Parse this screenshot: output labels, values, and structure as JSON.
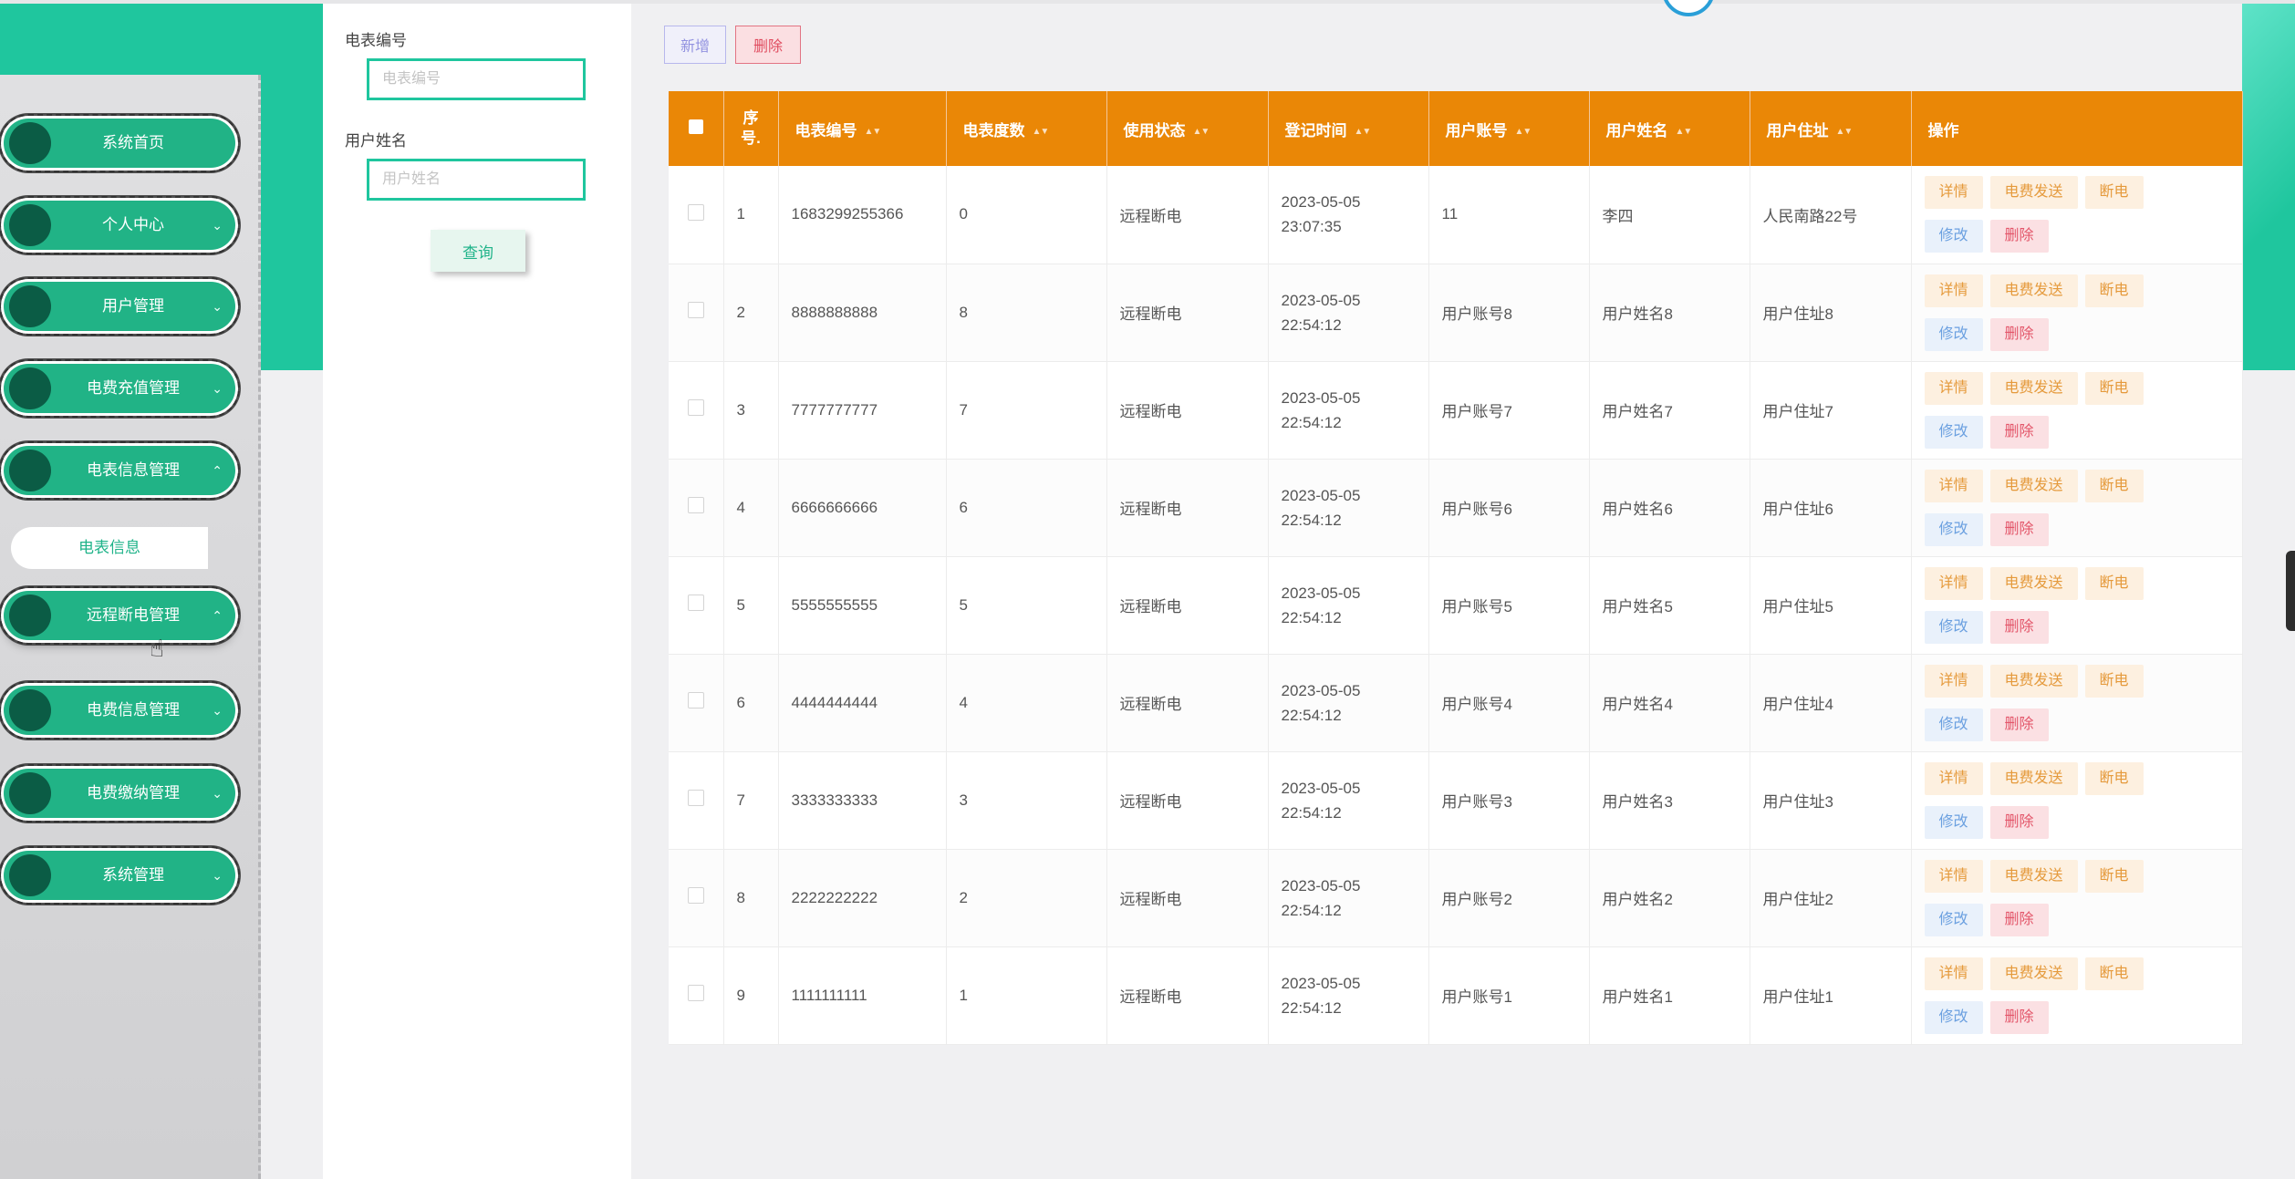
{
  "sidebar": {
    "items": [
      {
        "label": "系统首页",
        "chevron": ""
      },
      {
        "label": "个人中心",
        "chevron": "⌄"
      },
      {
        "label": "用户管理",
        "chevron": "⌄"
      },
      {
        "label": "电费充值管理",
        "chevron": "⌄"
      },
      {
        "label": "电表信息管理",
        "chevron": "⌃"
      },
      {
        "label": "远程断电管理",
        "chevron": "⌃"
      },
      {
        "label": "电费信息管理",
        "chevron": "⌄"
      },
      {
        "label": "电费缴纳管理",
        "chevron": "⌄"
      },
      {
        "label": "系统管理",
        "chevron": "⌄"
      }
    ],
    "submenu_item": "电表信息"
  },
  "search": {
    "meter_label": "电表编号",
    "meter_placeholder": "电表编号",
    "name_label": "用户姓名",
    "name_placeholder": "用户姓名",
    "query_button": "查询"
  },
  "toolbar": {
    "add_label": "新增",
    "delete_label": "删除"
  },
  "table": {
    "headers": {
      "index": "序号.",
      "meter_no": "电表编号",
      "meter_reading": "电表度数",
      "status": "使用状态",
      "register_time": "登记时间",
      "account": "用户账号",
      "name": "用户姓名",
      "address": "用户住址",
      "actions": "操作"
    },
    "actions": {
      "detail": "详情",
      "send": "电费发送",
      "cut": "断电",
      "edit": "修改",
      "delete": "删除"
    },
    "rows": [
      {
        "index": "1",
        "meter_no": "1683299255366",
        "reading": "0",
        "status": "远程断电",
        "time": "2023-05-05 23:07:35",
        "account": "11",
        "name": "李四",
        "address": "人民南路22号"
      },
      {
        "index": "2",
        "meter_no": "8888888888",
        "reading": "8",
        "status": "远程断电",
        "time": "2023-05-05 22:54:12",
        "account": "用户账号8",
        "name": "用户姓名8",
        "address": "用户住址8"
      },
      {
        "index": "3",
        "meter_no": "7777777777",
        "reading": "7",
        "status": "远程断电",
        "time": "2023-05-05 22:54:12",
        "account": "用户账号7",
        "name": "用户姓名7",
        "address": "用户住址7"
      },
      {
        "index": "4",
        "meter_no": "6666666666",
        "reading": "6",
        "status": "远程断电",
        "time": "2023-05-05 22:54:12",
        "account": "用户账号6",
        "name": "用户姓名6",
        "address": "用户住址6"
      },
      {
        "index": "5",
        "meter_no": "5555555555",
        "reading": "5",
        "status": "远程断电",
        "time": "2023-05-05 22:54:12",
        "account": "用户账号5",
        "name": "用户姓名5",
        "address": "用户住址5"
      },
      {
        "index": "6",
        "meter_no": "4444444444",
        "reading": "4",
        "status": "远程断电",
        "time": "2023-05-05 22:54:12",
        "account": "用户账号4",
        "name": "用户姓名4",
        "address": "用户住址4"
      },
      {
        "index": "7",
        "meter_no": "3333333333",
        "reading": "3",
        "status": "远程断电",
        "time": "2023-05-05 22:54:12",
        "account": "用户账号3",
        "name": "用户姓名3",
        "address": "用户住址3"
      },
      {
        "index": "8",
        "meter_no": "2222222222",
        "reading": "2",
        "status": "远程断电",
        "time": "2023-05-05 22:54:12",
        "account": "用户账号2",
        "name": "用户姓名2",
        "address": "用户住址2"
      },
      {
        "index": "9",
        "meter_no": "1111111111",
        "reading": "1",
        "status": "远程断电",
        "time": "2023-05-05 22:54:12",
        "account": "用户账号1",
        "name": "用户姓名1",
        "address": "用户住址1"
      }
    ]
  },
  "colors": {
    "brand_green": "#1fc69e",
    "header_orange": "#ea8706"
  }
}
